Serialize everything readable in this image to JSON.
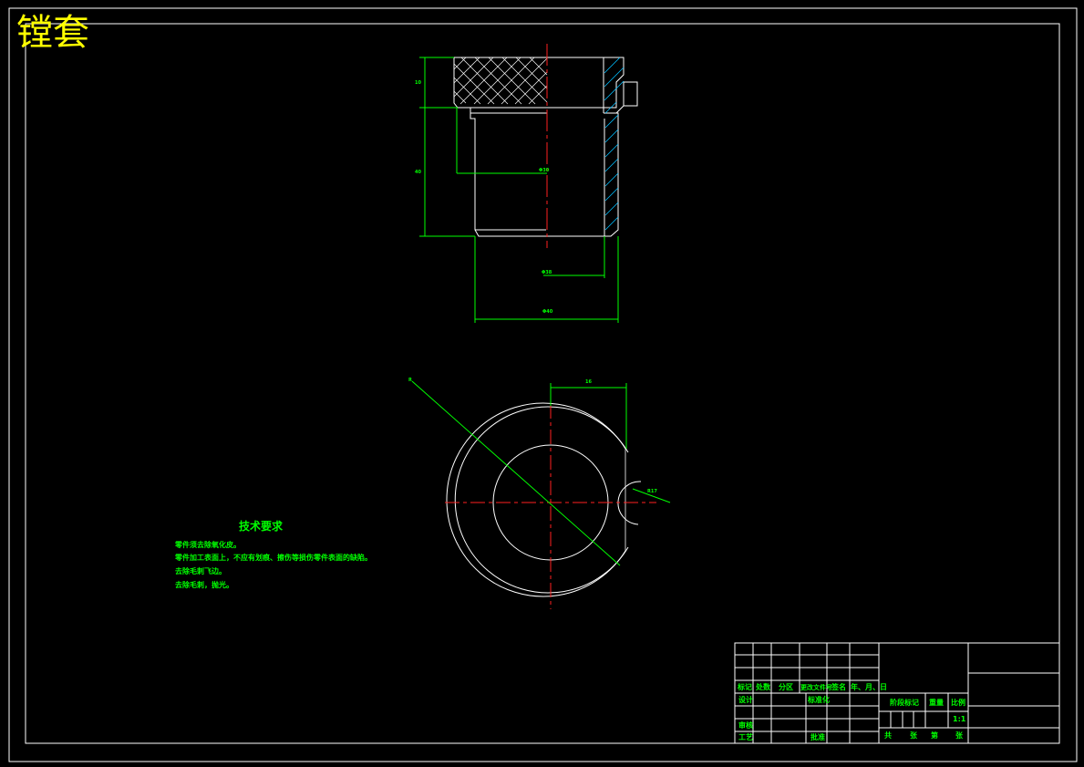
{
  "drawing": {
    "title": "镗套",
    "dimensions": {
      "height_top": "10",
      "height_body": "40",
      "inner_dia": "Φ30",
      "outer_dia": "Φ38",
      "total_dia": "Φ40",
      "radius_label": "R",
      "flat_offset": "16",
      "notch_label": "R17"
    },
    "tech_req": {
      "title": "技术要求",
      "lines": [
        "零件须去除氧化皮。",
        "零件加工表面上，不应有划痕、擦伤等损伤零件表面的缺陷。",
        "去除毛刺飞边。",
        "去除毛刺，抛光。"
      ]
    },
    "title_block": {
      "marks": "标记",
      "count": "处数",
      "zone": "分区",
      "doc_no": "更改文件号",
      "sign": "签名",
      "date": "年、月、日",
      "design": "设计",
      "standardize": "标准化",
      "review": "审核",
      "process": "工艺",
      "approve": "批准",
      "stage_mark": "阶段标记",
      "weight": "重量",
      "scale": "比例",
      "scale_value": "1:1",
      "total": "共",
      "sheets": "张",
      "page": "第",
      "sheet2": "张"
    }
  }
}
